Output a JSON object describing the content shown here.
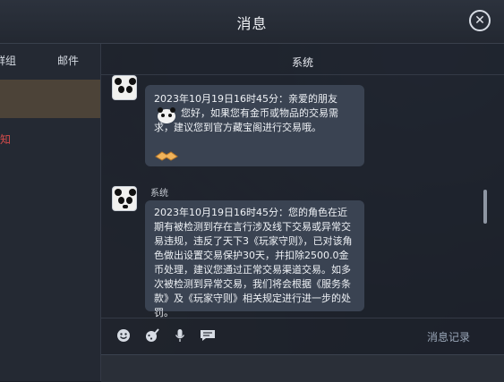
{
  "window": {
    "title": "消息"
  },
  "left_panel": {
    "tabs": [
      "群组",
      "邮件"
    ],
    "notice": "通知"
  },
  "system_tab": "系统",
  "messages": [
    {
      "text": "2023年10月19日16时45分：亲爱的朋友您好，如果您有金币或物品的交易需求，建议您到官方藏宝阁进行交易哦。",
      "text_line1": "2023年10月19日16时45分：亲爱的朋友",
      "text_line2": "您好，如果您有金币或物品的交易需",
      "text_line3": "求，建议您到官方藏宝阁进行交易哦。"
    },
    {
      "sender": "系统",
      "text": "2023年10月19日16时45分：您的角色在近期有被检测到存在言行涉及线下交易或异常交易违规，违反了天下3《玩家守则》，已对该角色做出设置交易保护30天，并扣除2500.0金币处理，建议您通过正常交易渠道交易。如多次被检测到异常交易，我们将会根据《服务条款》及《玩家守则》相关规定进行进一步的处罚。"
    }
  ],
  "toolbar": {
    "icons": [
      "emoji-icon",
      "brush-icon",
      "microphone-icon",
      "chat-bubble-icon"
    ],
    "history_label": "消息记录"
  }
}
